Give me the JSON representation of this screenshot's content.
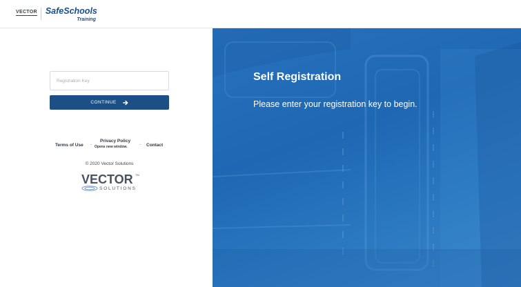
{
  "header": {
    "vector_small": "VECTOR",
    "safeschools_title": "SafeSchools",
    "safeschools_sub": "Training"
  },
  "form": {
    "registration_placeholder": "Registration Key",
    "registration_value": "",
    "continue_label": "CONTINUE"
  },
  "footer": {
    "terms_label": "Terms of Use",
    "separator": "-",
    "privacy_label": "Privacy Policy",
    "privacy_sub": "Opens new window.",
    "contact_label": "Contact",
    "copyright": "© 2020 Vector Solutions",
    "logo_word": "VECTOR",
    "logo_sub": "SOLUTIONS",
    "logo_tm": "TM"
  },
  "hero": {
    "title": "Self Registration",
    "message": "Please enter your registration key to begin."
  },
  "colors": {
    "brand_blue": "#1b4f85",
    "hero_blue": "#1e67b3",
    "safeschools_blue": "#1a4f8b"
  },
  "icons": {
    "continue_arrow": "arrow-right-icon"
  }
}
